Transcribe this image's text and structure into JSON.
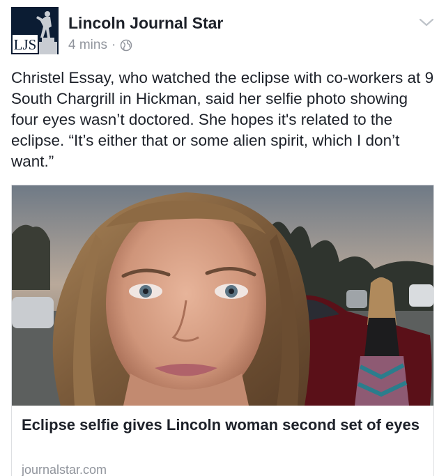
{
  "post": {
    "page_name": "Lincoln Journal Star",
    "avatar": {
      "logo_text": "LJS",
      "icon": "statue-icon"
    },
    "timestamp": "4 mins",
    "separator": "·",
    "audience_icon": "globe-icon",
    "menu_icon": "chevron-down-icon",
    "text": "Christel Essay, who watched the eclipse with co-workers at 9 South Chargrill in Hickman, said her selfie photo showing four eyes wasn’t doctored. She hopes it's related to the eclipse. “It’s either that or some alien spirit, which I don’t want.”"
  },
  "link_preview": {
    "title": "Eclipse selfie gives Lincoln woman second set of eyes",
    "domain": "journalstar.com"
  },
  "colors": {
    "text_primary": "#1d2129",
    "text_secondary": "#90949c",
    "card_border": "#dddfe2",
    "avatar_bg": "#0b1c33"
  }
}
